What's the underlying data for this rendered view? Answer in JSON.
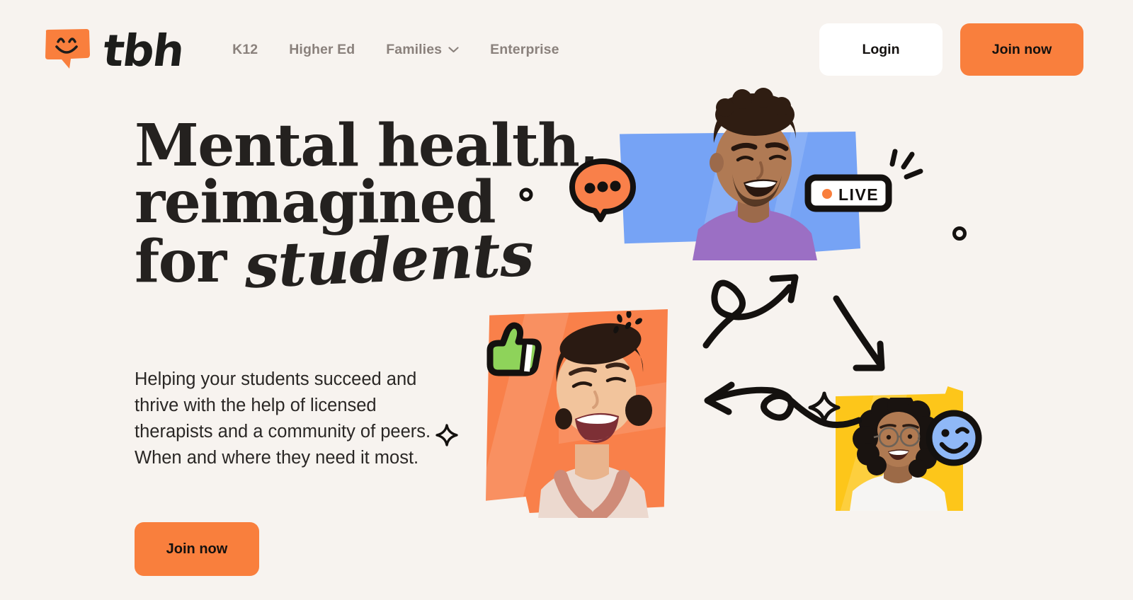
{
  "brand": {
    "name": "tbh",
    "logo_icon": "smiling-speech-bubble-icon",
    "logo_color": "#f97f3d"
  },
  "nav": {
    "items": [
      {
        "label": "K12",
        "has_dropdown": false
      },
      {
        "label": "Higher Ed",
        "has_dropdown": false
      },
      {
        "label": "Families",
        "has_dropdown": true,
        "dropdown_icon": "chevron-down-icon"
      },
      {
        "label": "Enterprise",
        "has_dropdown": false
      }
    ]
  },
  "header_actions": {
    "login_label": "Login",
    "join_label": "Join now"
  },
  "hero": {
    "headline_line1": "Mental health,",
    "headline_line2": "reimagined",
    "headline_line3": "for",
    "headline_script": "students",
    "paragraph": "Helping your students succeed and thrive with the help of licensed therapists and a community of peers. When and where they need it most.",
    "cta_label": "Join now"
  },
  "collage": {
    "live_badge": {
      "label": "LIVE",
      "dot_color": "#f97f3d"
    },
    "cards": [
      {
        "name": "student-photo-blue",
        "color": "#76a3f5",
        "subject": "smiling young man in purple shirt"
      },
      {
        "name": "student-photo-orange",
        "color": "#f9804a",
        "subject": "laughing young woman in rust tank top"
      },
      {
        "name": "student-photo-yellow",
        "color": "#fdc61a",
        "subject": "smiling young woman with glasses in white tee"
      }
    ],
    "stickers": [
      {
        "name": "chat-bubble-icon",
        "color": "#f9804a"
      },
      {
        "name": "live-badge",
        "color": "#ffffff"
      },
      {
        "name": "thumbs-up-icon",
        "color": "#8ed35a"
      },
      {
        "name": "winking-smiley-icon",
        "color": "#8fb8f7"
      },
      {
        "name": "sparkle-icon",
        "color": "#14110f"
      },
      {
        "name": "burst-lines-icon",
        "color": "#14110f"
      }
    ],
    "arrows": [
      {
        "name": "looping-arrow-up-right"
      },
      {
        "name": "curved-arrow-down"
      },
      {
        "name": "looping-arrow-left"
      }
    ]
  },
  "theme": {
    "background": "#f7f3ef",
    "accent_orange": "#f97f3d",
    "text_dark": "#24211f",
    "text_muted": "#8a817c",
    "blue": "#76a3f5",
    "yellow": "#fdc61a",
    "green": "#8ed35a"
  }
}
